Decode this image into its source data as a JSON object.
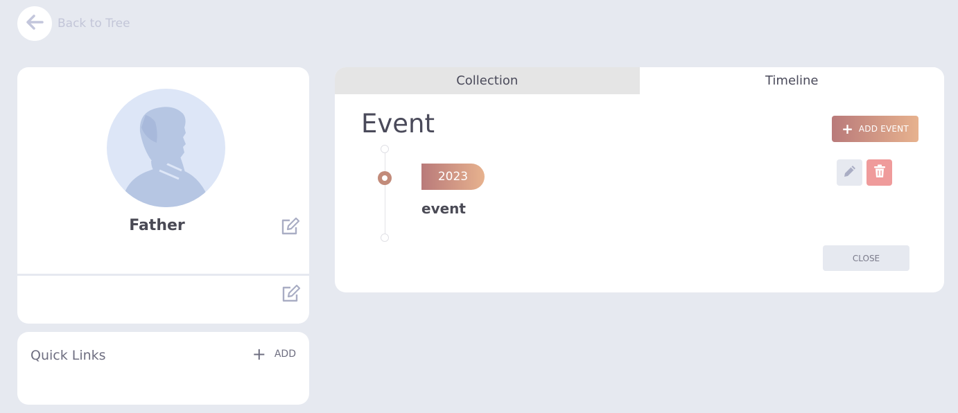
{
  "nav": {
    "back_label": "Back to Tree",
    "back_icon": "arrow-left-icon"
  },
  "profile": {
    "name": "Father",
    "avatar_icon": "person-silhouette",
    "edit_icon": "edit-icon"
  },
  "quick_links": {
    "title": "Quick Links",
    "add_label": "ADD",
    "add_icon": "plus-icon"
  },
  "tabs": [
    {
      "label": "Collection",
      "active": false
    },
    {
      "label": "Timeline",
      "active": true
    }
  ],
  "timeline": {
    "title": "Event",
    "add_button_label": "ADD EVENT",
    "events": [
      {
        "year": "2023",
        "title": "event"
      }
    ],
    "close_label": "CLOSE"
  },
  "colors": {
    "background": "#e6e9f0",
    "accent_gradient_start": "#b97a7a",
    "accent_gradient_end": "#e7b28e",
    "delete": "#ef9b9b",
    "timeline_dot": "#c28b7a"
  }
}
